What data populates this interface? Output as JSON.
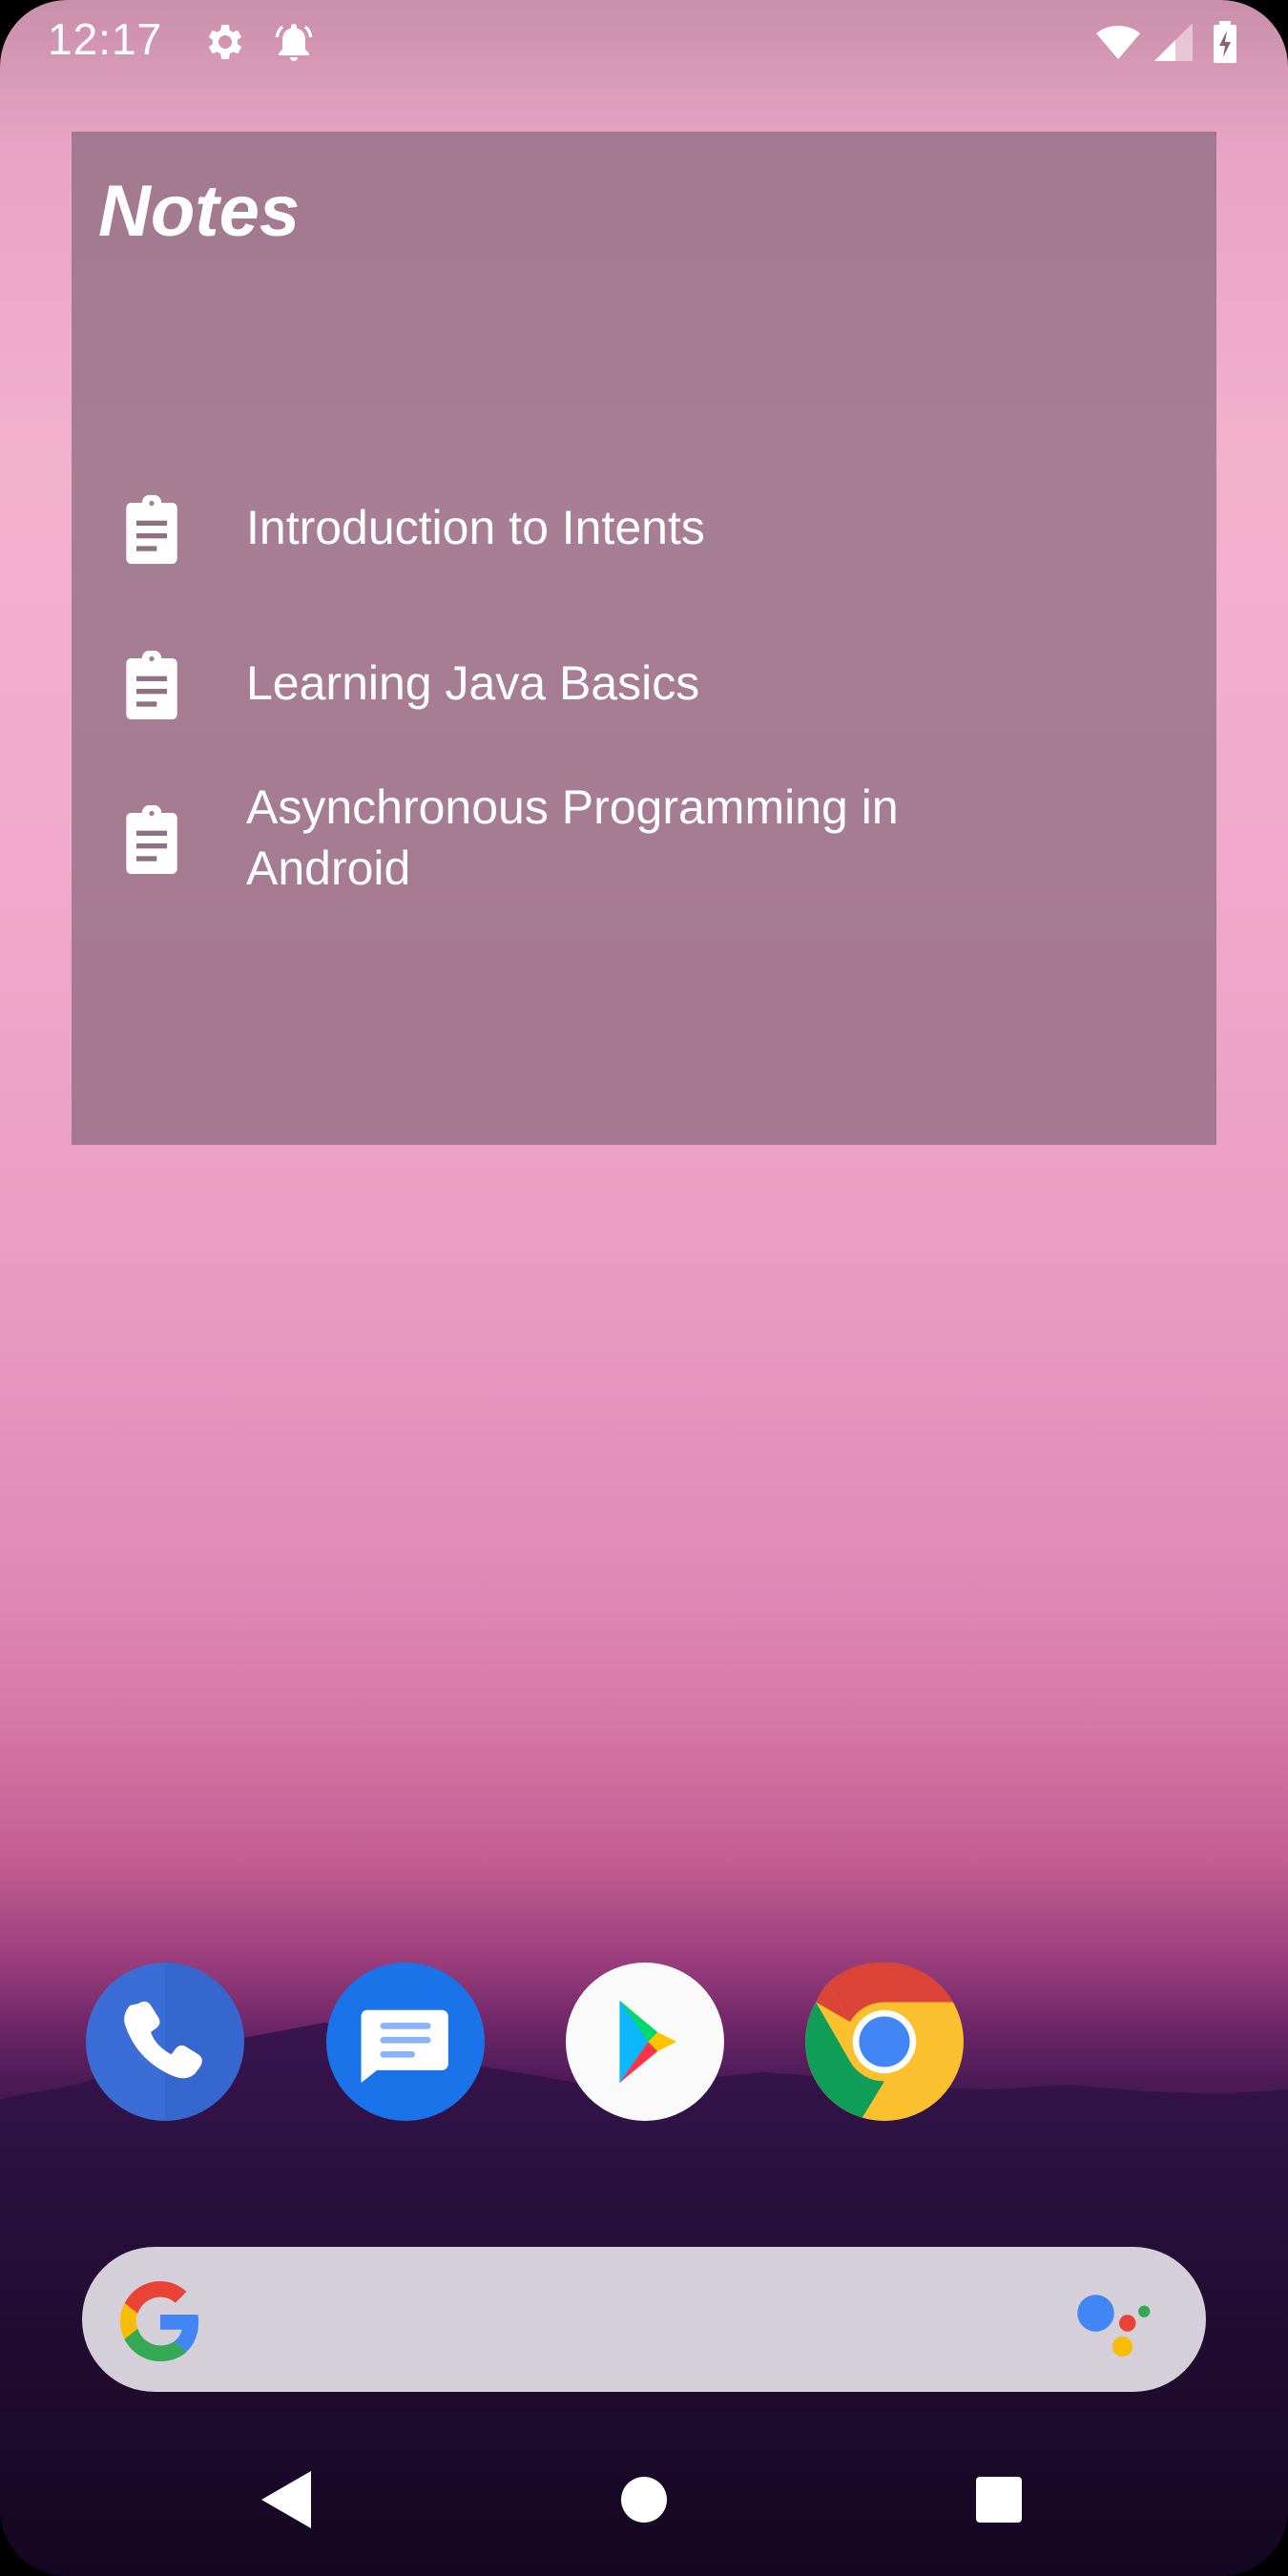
{
  "status_bar": {
    "time": "12:17",
    "left_icons": [
      "settings-gear-icon",
      "alarm-bell-icon"
    ],
    "right_icons": [
      "wifi-icon",
      "cell-signal-icon",
      "battery-charging-icon"
    ]
  },
  "widget": {
    "title": "Notes",
    "notes": [
      {
        "icon": "clipboard-icon",
        "title": "Introduction to Intents"
      },
      {
        "icon": "clipboard-icon",
        "title": "Learning Java Basics"
      },
      {
        "icon": "clipboard-icon",
        "title": "Asynchronous Programming in Android"
      }
    ]
  },
  "dock": {
    "apps": [
      {
        "name": "Phone",
        "icon": "phone-icon"
      },
      {
        "name": "Messages",
        "icon": "messages-icon"
      },
      {
        "name": "Play Store",
        "icon": "play-store-icon"
      },
      {
        "name": "Chrome",
        "icon": "chrome-icon"
      }
    ]
  },
  "search": {
    "placeholder": "",
    "left_icon": "google-g-icon",
    "right_icon": "google-assistant-icon"
  },
  "nav": {
    "back": "back-triangle-icon",
    "home": "home-circle-icon",
    "recents": "recents-square-icon"
  },
  "colors": {
    "widget_bg": "#786070",
    "searchbar_bg": "#d4cfd8",
    "phone_blue": "#3b6dd6",
    "messages_blue": "#1a73e8"
  }
}
